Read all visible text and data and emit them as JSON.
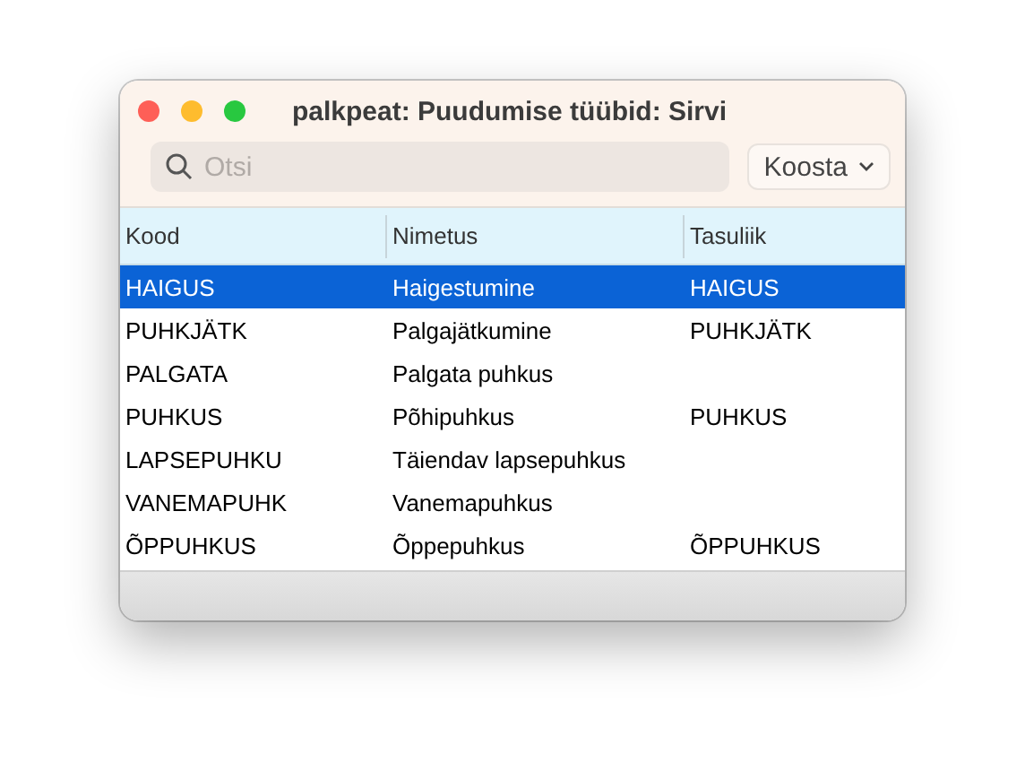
{
  "window": {
    "title": "palkpeat: Puudumise tüübid: Sirvi"
  },
  "search": {
    "placeholder": "Otsi"
  },
  "menu_button": {
    "label": "Koosta"
  },
  "table": {
    "columns": [
      "Kood",
      "Nimetus",
      "Tasuliik"
    ],
    "rows": [
      {
        "cells": [
          "HAIGUS",
          "Haigestumine",
          "HAIGUS"
        ],
        "selected": true
      },
      {
        "cells": [
          "PUHKJÄTK",
          "Palgajätkumine",
          "PUHKJÄTK"
        ],
        "selected": false
      },
      {
        "cells": [
          "PALGATA",
          "Palgata puhkus"
        ],
        "selected": false
      },
      {
        "cells": [
          "PUHKUS",
          "Põhipuhkus",
          "PUHKUS"
        ],
        "selected": false
      },
      {
        "cells": [
          "LAPSEPUHKU",
          "Täiendav lapsepuhkus"
        ],
        "selected": false
      },
      {
        "cells": [
          "VANEMAPUHK",
          "Vanemapuhkus"
        ],
        "selected": false
      },
      {
        "cells": [
          "ÕPPUHKUS",
          "Õppepuhkus",
          "ÕPPUHKUS"
        ],
        "selected": false
      }
    ]
  }
}
